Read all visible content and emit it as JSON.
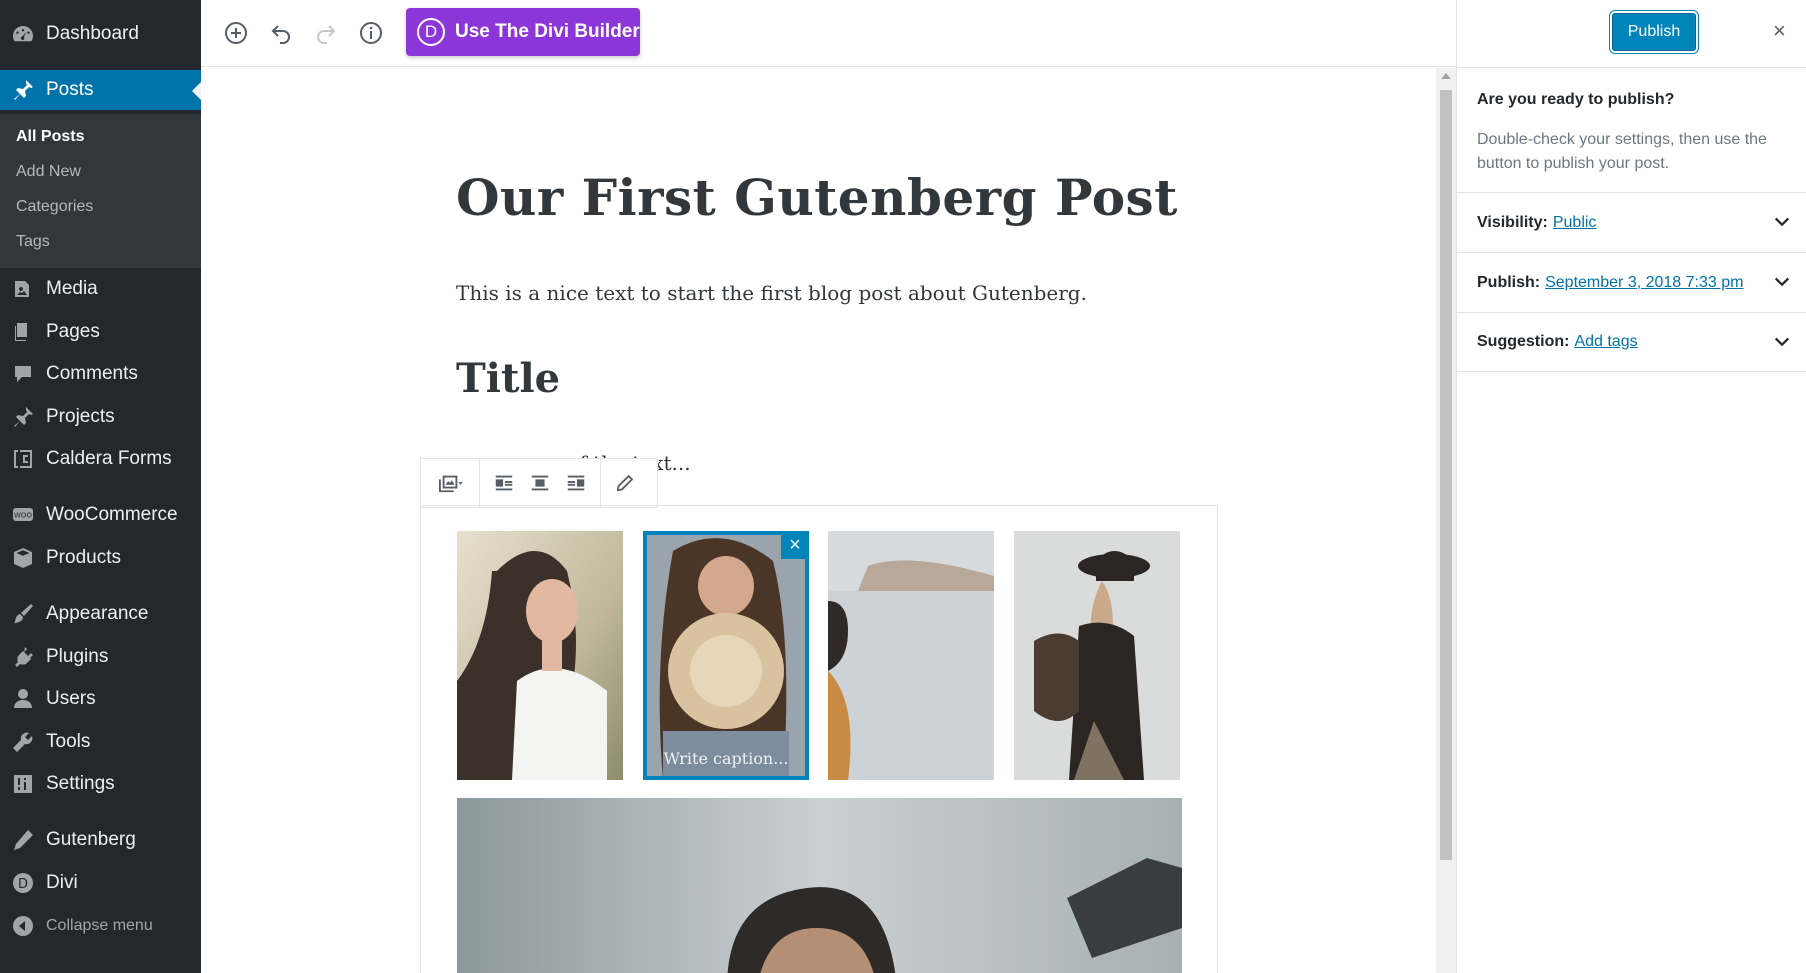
{
  "sidebar": {
    "items": [
      {
        "label": "Dashboard",
        "icon": "dashboard-icon"
      },
      {
        "label": "Posts",
        "icon": "pin-icon"
      },
      {
        "label": "Media",
        "icon": "media-icon"
      },
      {
        "label": "Pages",
        "icon": "pages-icon"
      },
      {
        "label": "Comments",
        "icon": "comments-icon"
      },
      {
        "label": "Projects",
        "icon": "pin-icon"
      },
      {
        "label": "Caldera Forms",
        "icon": "caldera-icon"
      },
      {
        "label": "WooCommerce",
        "icon": "woo-icon"
      },
      {
        "label": "Products",
        "icon": "box-icon"
      },
      {
        "label": "Appearance",
        "icon": "brush-icon"
      },
      {
        "label": "Plugins",
        "icon": "plug-icon"
      },
      {
        "label": "Users",
        "icon": "user-icon"
      },
      {
        "label": "Tools",
        "icon": "wrench-icon"
      },
      {
        "label": "Settings",
        "icon": "sliders-icon"
      },
      {
        "label": "Gutenberg",
        "icon": "pencil-icon"
      },
      {
        "label": "Divi",
        "icon": "divi-icon"
      }
    ],
    "submenu": [
      "All Posts",
      "Add New",
      "Categories",
      "Tags"
    ],
    "collapse_label": "Collapse menu"
  },
  "toolbar": {
    "divi_button_label": "Use The Divi Builder",
    "divi_letter": "D"
  },
  "editor": {
    "post_title": "Our First Gutenberg Post",
    "paragraph_1": "This is a nice text to start the first blog post about Gutenberg.",
    "heading": "Title",
    "paragraph_2_visible": "of the text...",
    "gallery": {
      "caption_placeholder": "Write caption...",
      "remove_glyph": "×"
    }
  },
  "panel": {
    "publish_label": "Publish",
    "close_glyph": "×",
    "ready_question": "Are you ready to publish?",
    "ready_description": "Double-check your settings, then use the button to publish your post.",
    "rows": [
      {
        "label": "Visibility:",
        "value": "Public"
      },
      {
        "label": "Publish:",
        "value": "September 3, 2018 7:33 pm"
      },
      {
        "label": "Suggestion:",
        "value": "Add tags"
      }
    ]
  },
  "colors": {
    "admin_bg": "#23282d",
    "admin_active": "#0073aa",
    "divi_purple": "#8c35d9",
    "publish_blue": "#0085ba"
  }
}
